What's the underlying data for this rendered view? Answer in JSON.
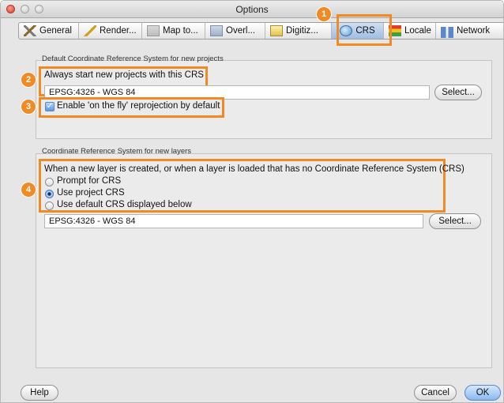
{
  "window": {
    "title": "Options"
  },
  "tabs": [
    {
      "label": "General",
      "icon": "hammer-icon"
    },
    {
      "label": "Render...",
      "icon": "brush-icon"
    },
    {
      "label": "Map to...",
      "icon": "map-tools-icon"
    },
    {
      "label": "Overl...",
      "icon": "overlay-icon"
    },
    {
      "label": "Digitiz...",
      "icon": "digitizing-icon"
    },
    {
      "label": "CRS",
      "icon": "globe-icon",
      "active": true
    },
    {
      "label": "Locale",
      "icon": "flag-icon"
    },
    {
      "label": "Network",
      "icon": "network-icon"
    }
  ],
  "badges": [
    "1",
    "2",
    "3",
    "4"
  ],
  "group_projects": {
    "title": "Default Coordinate Reference System for new projects",
    "label": "Always start new projects with this CRS",
    "crs_value": "EPSG:4326 - WGS 84",
    "select_label": "Select...",
    "otf_label": "Enable 'on the fly' reprojection by default",
    "otf_checked": true
  },
  "group_layers": {
    "title": "Coordinate Reference System for new layers",
    "description": "When a new layer is created, or when a layer is loaded that has no Coordinate Reference System (CRS)",
    "options": [
      "Prompt for CRS",
      "Use project CRS",
      "Use default CRS displayed below"
    ],
    "selected_option": "Use project CRS",
    "crs_value": "EPSG:4326 - WGS 84",
    "select_label": "Select..."
  },
  "footer": {
    "help_label": "Help",
    "cancel_label": "Cancel",
    "ok_label": "OK"
  },
  "colors": {
    "highlight": "#f08a24",
    "default_button": "#8ab8ef"
  }
}
